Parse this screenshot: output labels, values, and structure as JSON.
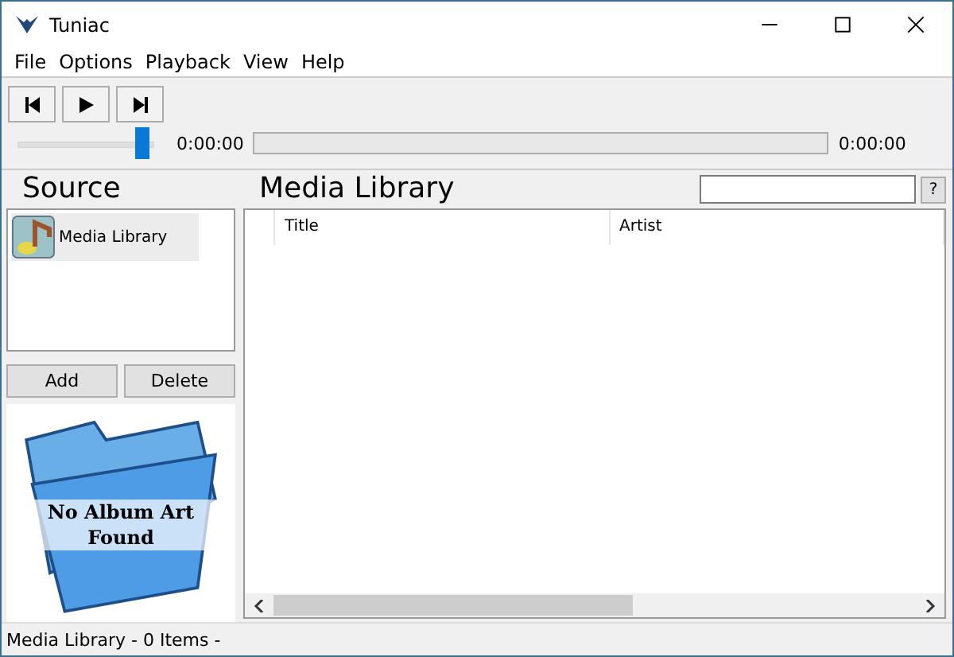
{
  "window": {
    "title": "Tuniac"
  },
  "menu": [
    "File",
    "Options",
    "Playback",
    "View",
    "Help"
  ],
  "transport": [
    {
      "kind": "prev"
    },
    {
      "kind": "play"
    },
    {
      "kind": "next"
    }
  ],
  "volume": {
    "level": 0.93
  },
  "seek": {
    "elapsed": "0:00:00",
    "total": "0:00:00"
  },
  "source": {
    "title": "Source",
    "items": [
      {
        "label": "Media Library",
        "selected": true
      }
    ],
    "buttons": [
      "Add",
      "Delete"
    ],
    "album_art": {
      "text": "No Album Art Found"
    }
  },
  "library": {
    "title": "Media Library",
    "help_button": "?",
    "columns": [
      "Title",
      "Artist"
    ]
  },
  "status_bar": "Media Library - 0 Items -"
}
